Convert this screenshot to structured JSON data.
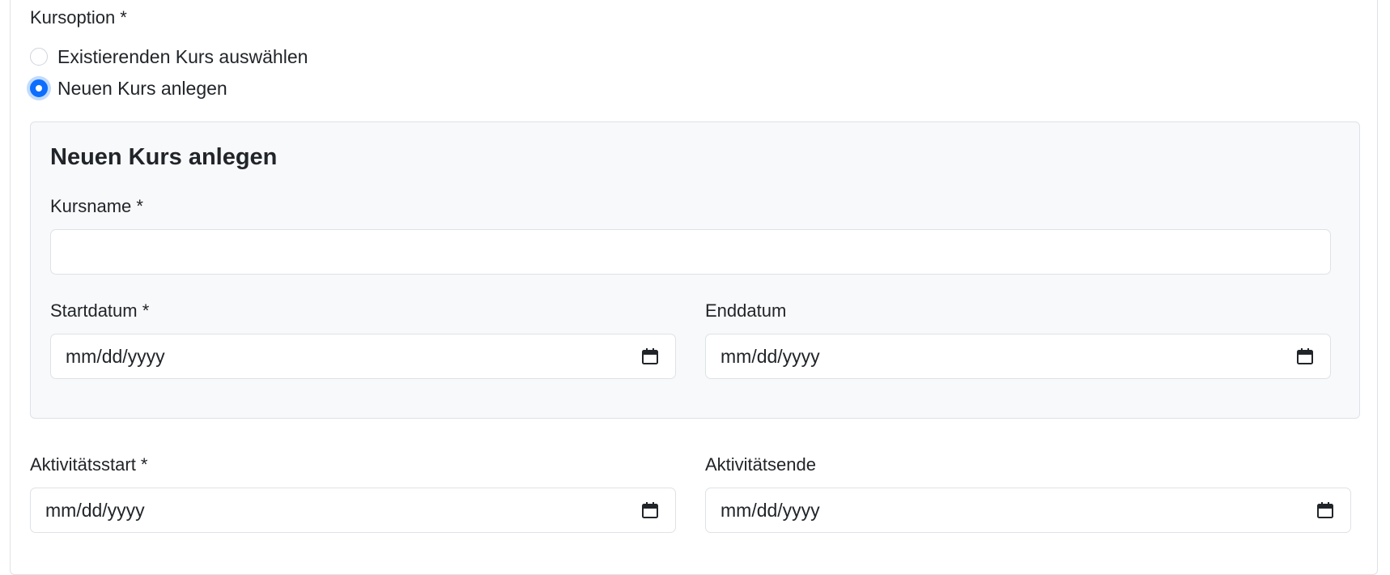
{
  "course_option": {
    "label": "Kursoption *",
    "options": [
      {
        "label": "Existierenden Kurs auswählen",
        "checked": false
      },
      {
        "label": "Neuen Kurs anlegen",
        "checked": true
      }
    ]
  },
  "new_course_panel": {
    "title": "Neuen Kurs anlegen",
    "course_name": {
      "label": "Kursname *",
      "value": "",
      "placeholder": ""
    },
    "start_date": {
      "label": "Startdatum *",
      "placeholder": "mm/dd/yyyy"
    },
    "end_date": {
      "label": "Enddatum",
      "placeholder": "mm/dd/yyyy"
    }
  },
  "activity": {
    "start": {
      "label": "Aktivitätsstart *",
      "placeholder": "mm/dd/yyyy"
    },
    "end": {
      "label": "Aktivitätsende",
      "placeholder": "mm/dd/yyyy"
    }
  },
  "icons": {
    "calendar": "calendar-icon"
  },
  "colors": {
    "accent": "#0d6efd",
    "panel_bg": "#f8f9fa",
    "border": "#dee2e6",
    "text": "#212529"
  }
}
